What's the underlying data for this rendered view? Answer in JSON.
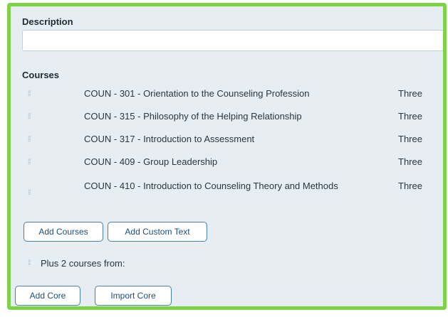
{
  "description": {
    "label": "Description",
    "value": "",
    "placeholder": ""
  },
  "courses": {
    "label": "Courses",
    "items": [
      {
        "name": "COUN - 301 - Orientation to the Counseling Profession",
        "credits": "Three"
      },
      {
        "name": "COUN - 315 - Philosophy of the Helping Relationship",
        "credits": "Three"
      },
      {
        "name": "COUN - 317 - Introduction to Assessment",
        "credits": "Three"
      },
      {
        "name": "COUN - 409 - Group Leadership",
        "credits": "Three"
      },
      {
        "name": "COUN - 410 - Introduction to Counseling Theory and Methods",
        "credits": "Three"
      }
    ],
    "add_courses_label": "Add Courses",
    "add_custom_text_label": "Add Custom Text"
  },
  "plus": {
    "text": "Plus 2 courses from:"
  },
  "footer": {
    "add_core_label": "Add Core",
    "import_core_label": "Import Core"
  },
  "colors": {
    "frame_border": "#7ed24a",
    "panel_background": "#e6eef3",
    "button_border": "#4a7fa7"
  }
}
